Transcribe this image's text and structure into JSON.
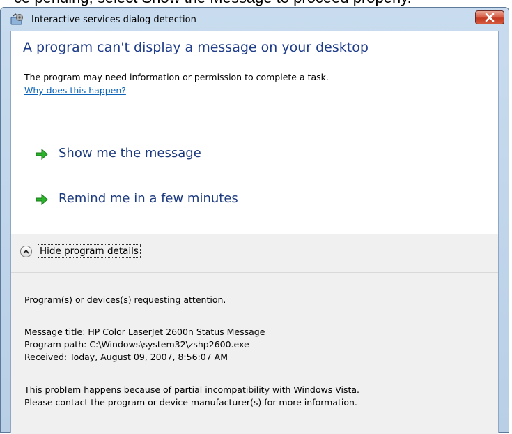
{
  "background": {
    "partial_text": "ce pending, select Show the Message to proceed properly."
  },
  "window": {
    "title": "Interactive services dialog detection",
    "icon": "services-gear-icon",
    "close_icon": "close-icon"
  },
  "main": {
    "heading": "A program can't display a message on your desktop",
    "info": "The program may need information or permission to complete a task.",
    "why_link": "Why does this happen?"
  },
  "commands": [
    {
      "label": "Show me the message",
      "icon": "green-arrow-icon"
    },
    {
      "label": "Remind me in a few minutes",
      "icon": "green-arrow-icon"
    }
  ],
  "details": {
    "toggle_label": "Hide program details",
    "toggle_icon": "chevron-up-icon",
    "requesting": "Program(s) or devices(s) requesting attention.",
    "message_title": "Message title:  HP Color LaserJet 2600n Status Message",
    "program_path": "Program path:  C:\\Windows\\system32\\zshp2600.exe",
    "received": "Received:  Today, August 09, 2007, 8:56:07 AM",
    "problem_line1": "This problem happens because of partial incompatibility with Windows Vista.",
    "problem_line2": "Please contact the program or device manufacturer(s) for more information."
  },
  "colors": {
    "heading": "#1f3d8a",
    "link": "#0d63b8",
    "arrow": "#2bb32b",
    "close": "#c23a22",
    "details_bg": "#f0f0f0"
  }
}
